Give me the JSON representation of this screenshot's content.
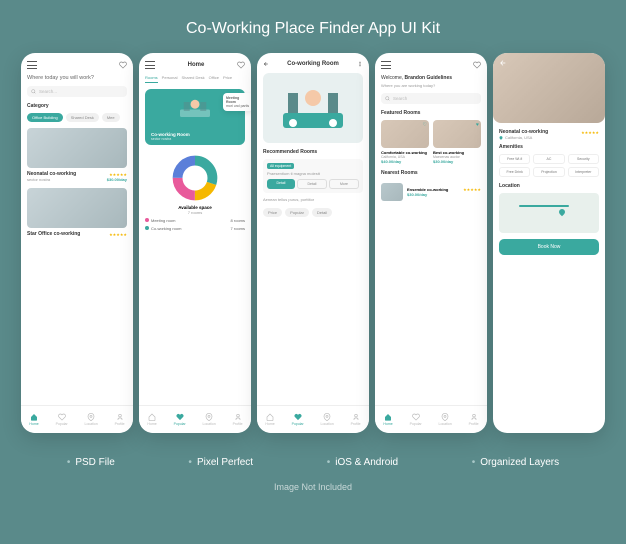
{
  "title": "Co-Working Place Finder App UI Kit",
  "features": [
    "PSD File",
    "Pixel Perfect",
    "iOS & Android",
    "Organized Layers"
  ],
  "footer": "Image Not Included",
  "colors": {
    "accent": "#3aa99f",
    "bg": "#5a8a8a"
  },
  "nav": {
    "home": "Home",
    "popular": "Popular",
    "location": "Location",
    "profile": "Profile"
  },
  "screen1": {
    "question": "Where today you will work?",
    "search_ph": "Search...",
    "cat_label": "Category",
    "cats": [
      "Office Building",
      "Shared Desk",
      "Mee"
    ],
    "listing1": {
      "title": "Neonatal co-working",
      "sub": "sector nostra",
      "price": "$30.00/day",
      "stars": "★★★★★"
    },
    "listing2": {
      "title": "Star Office co-working",
      "stars": "★★★★★"
    }
  },
  "screen2": {
    "title": "Home",
    "tabs": [
      "Rooms",
      "Personal",
      "Shared Desk",
      "Office",
      "Price"
    ],
    "hero": {
      "title": "Co-working Room",
      "sub": "sector nostra"
    },
    "meeting": {
      "title": "Meeting Room",
      "sub": "mori und partis"
    },
    "avail_label": "Available space",
    "avail_sub": "7 rooms",
    "stat1": {
      "label": "Meeting room",
      "val": "8 rooms"
    },
    "stat2": {
      "label": "Co-working room",
      "val": "7 rooms"
    }
  },
  "screen3": {
    "title": "Co-working Room",
    "rec_label": "Recommended Rooms",
    "rec_badge": "All equipment",
    "rec_sub": "Praesentium ti magna molestt",
    "btns": [
      "Detail",
      "Detail",
      "More"
    ],
    "desc": "Aenean tellus purus, porttitor",
    "filters": [
      "Price",
      "Popular",
      "Detail"
    ]
  },
  "screen4": {
    "welcome_pre": "Welcome, ",
    "welcome_name": "Brandon Guidelines",
    "welcome_q": "Where you are working today?",
    "search_ph": "Search",
    "feat_label": "Featured Rooms",
    "card1": {
      "title": "Comfortable co-working",
      "sub": "California, USA",
      "price": "$40.00/day"
    },
    "card2": {
      "title": "Best co-working",
      "sub": "Maecenas auctor",
      "price": "$30.00/day"
    },
    "near_label": "Nearest Rooms",
    "near1": {
      "title": "Ensemble co-working",
      "price": "$30.00/day",
      "stars": "★★★★★"
    }
  },
  "screen5": {
    "title": "Neonatal co-working",
    "loc": "California, USA",
    "stars": "★★★★★",
    "amen_label": "Amenities",
    "amens": [
      "Free Wi-fi",
      "AC",
      "Security",
      "Free Drink",
      "Projection",
      "Interpreter"
    ],
    "loc_label": "Location",
    "book": "Book Now"
  }
}
